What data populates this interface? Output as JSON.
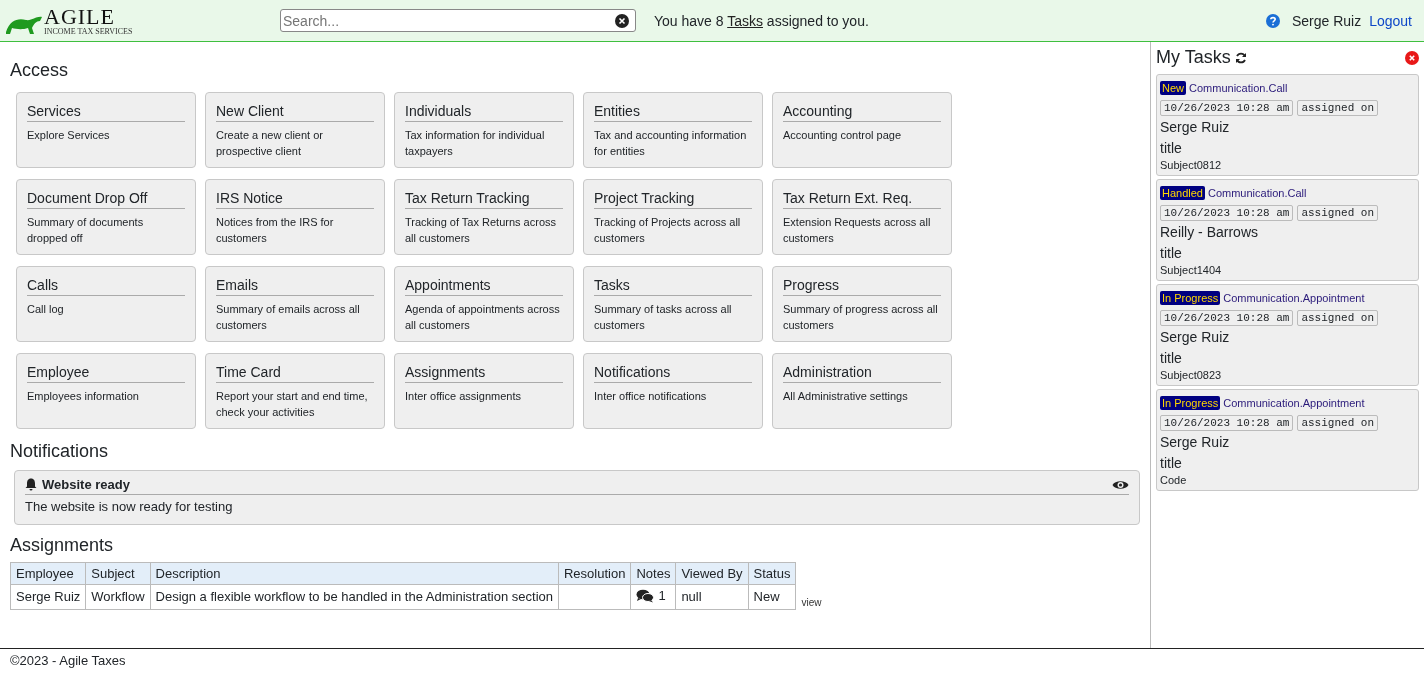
{
  "header": {
    "logo_text": "AGILE",
    "logo_tagline": "INCOME TAX SERVICES",
    "search": {
      "placeholder": "Search..."
    },
    "message_before": "You have 8",
    "message_link": "Tasks",
    "message_after": "assigned to you.",
    "user": "Serge Ruiz",
    "logout": "Logout"
  },
  "access": {
    "title": "Access",
    "cards": [
      {
        "title": "Services",
        "description": "Explore Services"
      },
      {
        "title": "New Client",
        "description": "Create a new client or prospective client"
      },
      {
        "title": "Individuals",
        "description": "Tax information for individual taxpayers"
      },
      {
        "title": "Entities",
        "description": "Tax and accounting information for entities"
      },
      {
        "title": "Accounting",
        "description": "Accounting control page"
      },
      {
        "title": "Document Drop Off",
        "description": "Summary of documents dropped off"
      },
      {
        "title": "IRS Notice",
        "description": "Notices from the IRS for customers"
      },
      {
        "title": "Tax Return Tracking",
        "description": "Tracking of Tax Returns across all customers"
      },
      {
        "title": "Project Tracking",
        "description": "Tracking of Projects across all customers"
      },
      {
        "title": "Tax Return Ext. Req.",
        "description": "Extension Requests across all customers"
      },
      {
        "title": "Calls",
        "description": "Call log"
      },
      {
        "title": "Emails",
        "description": "Summary of emails across all customers"
      },
      {
        "title": "Appointments",
        "description": "Agenda of appointments across all customers"
      },
      {
        "title": "Tasks",
        "description": "Summary of tasks across all customers"
      },
      {
        "title": "Progress",
        "description": "Summary of progress across all customers"
      },
      {
        "title": "Employee",
        "description": "Employees information"
      },
      {
        "title": "Time Card",
        "description": "Report your start and end time, check your activities"
      },
      {
        "title": "Assignments",
        "description": "Inter office assignments"
      },
      {
        "title": "Notifications",
        "description": "Inter office notifications"
      },
      {
        "title": "Administration",
        "description": "All Administrative settings"
      }
    ]
  },
  "notifications": {
    "title": "Notifications",
    "items": [
      {
        "title": "Website ready",
        "body": "The website is now ready for testing"
      }
    ]
  },
  "assignments": {
    "title": "Assignments",
    "columns": [
      "Employee",
      "Subject",
      "Description",
      "Resolution",
      "Notes",
      "Viewed By",
      "Status"
    ],
    "rows": [
      {
        "employee": "Serge Ruiz",
        "subject": "Workflow",
        "description": "Design a flexible workflow to be handled in the Administration section",
        "resolution": "",
        "notes": "1",
        "viewed_by": "null",
        "status": "New",
        "action": "view"
      }
    ]
  },
  "my_tasks": {
    "title": "My Tasks",
    "items": [
      {
        "status": "New",
        "type": "Communication.Call",
        "date": "10/26/2023 10:28 am",
        "date_label": "assigned on",
        "name": "Serge Ruiz",
        "title": "title",
        "subject": "Subject0812"
      },
      {
        "status": "Handled",
        "type": "Communication.Call",
        "date": "10/26/2023 10:28 am",
        "date_label": "assigned on",
        "name": "Reilly - Barrows",
        "title": "title",
        "subject": "Subject1404"
      },
      {
        "status": "In Progress",
        "type": "Communication.Appointment",
        "date": "10/26/2023 10:28 am",
        "date_label": "assigned on",
        "name": "Serge Ruiz",
        "title": "title",
        "subject": "Subject0823"
      },
      {
        "status": "In Progress",
        "type": "Communication.Appointment",
        "date": "10/26/2023 10:28 am",
        "date_label": "assigned on",
        "name": "Serge Ruiz",
        "title": "title",
        "subject": "Code"
      }
    ]
  },
  "footer": "©2023 - Agile Taxes"
}
